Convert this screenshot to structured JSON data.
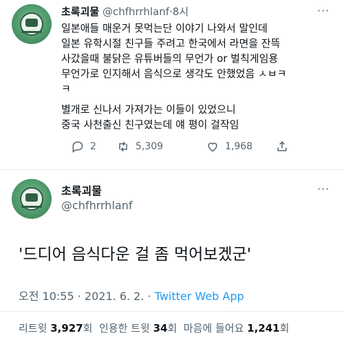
{
  "tweet1": {
    "display_name": "초록괴물",
    "handle": "@chfhrrhlanf",
    "separator": "·",
    "time_ago": "8시",
    "more_icon": "more-icon",
    "lines": [
      "일본애들 매운거 못먹는단 이야기 나와서 말인데",
      "일본 유학시절 친구들 주려고 한국에서 라면을 잔뜩",
      "사갔을때 불닭은 유튜버들의 무언가 or 벌칙게임용",
      "무언가로 인지해서 음식으로 생각도 안했었음 ㅅㅂㅋ",
      "ㅋ",
      "",
      "별개로 신나서 가져가는 이들이 있었으니",
      "중국 사천출신 친구였는데 얘 평이 걸작임"
    ],
    "reply_count": "2",
    "retweet_count": "5,309",
    "like_count": "1,968"
  },
  "tweet2": {
    "display_name": "초록괴물",
    "handle": "@chfhrrhlanf",
    "text": "'드디어 음식다운 걸 좀 먹어보겠군'",
    "time": "오전 10:55",
    "separator": "·",
    "date": "2021. 6. 2.",
    "source": "Twitter Web App",
    "retweets_label": "리트윗",
    "retweets_value": "3,927",
    "retweets_unit": "회",
    "quotes_label": "인용한 트윗",
    "quotes_value": "34",
    "quotes_unit": "회",
    "likes_label": "마음에 들어요",
    "likes_value": "1,241",
    "likes_unit": "회"
  },
  "colors": {
    "text": "#0f1419",
    "muted": "#536471",
    "link": "#1d9bf0",
    "divider": "#e6ecf0"
  }
}
